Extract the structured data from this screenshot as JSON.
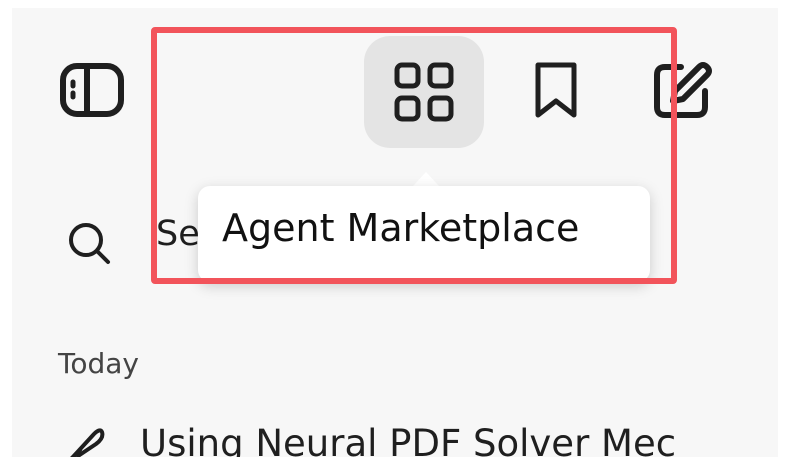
{
  "toolbar": {
    "sidebar_toggle_icon": "sidebar-toggle-icon",
    "marketplace_icon": "grid-icon",
    "bookmark_icon": "bookmark-icon",
    "compose_icon": "compose-icon"
  },
  "tooltip": {
    "text": "Agent Marketplace"
  },
  "search": {
    "label": "Se",
    "icon": "search-icon"
  },
  "history": {
    "section_label": "Today",
    "items": [
      {
        "title": "Using Neural PDF Solver Mec",
        "icon": "feather-icon"
      }
    ]
  },
  "colors": {
    "sidebar_bg": "#f7f7f7",
    "active_button_bg": "#e4e4e4",
    "highlight_border": "#f2545b",
    "text": "#1f1f1f"
  }
}
